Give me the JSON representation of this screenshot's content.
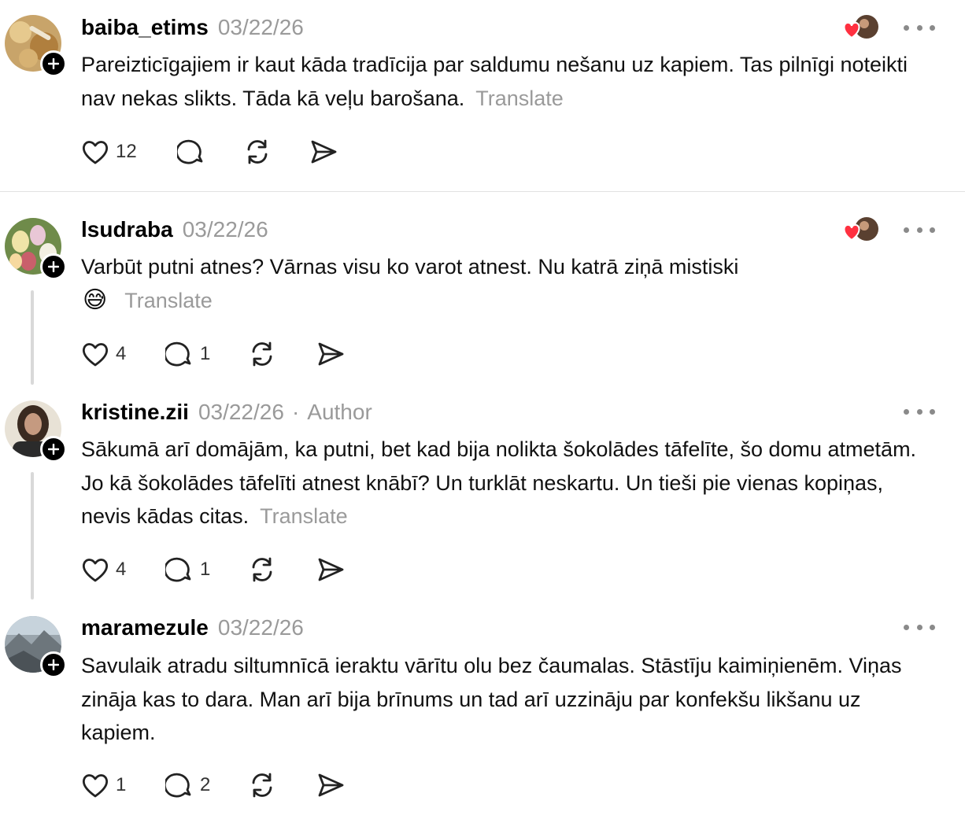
{
  "posts": [
    {
      "username": "baiba_etims",
      "date": "03/22/26",
      "text": "Pareizticīgajiem ir kaut kāda tradīcija par saldumu nešanu uz kapiem. Tas pilnīgi noteikti nav nekas slikts. Tāda kā veļu barošana.",
      "translate": "Translate",
      "likes": "12",
      "replies": "",
      "liked_by_op": true
    },
    {
      "username": "lsudraba",
      "date": "03/22/26",
      "text": "Varbūt putni atnes? Vārnas visu ko varot atnest. Nu katrā ziņā mistiski",
      "emoji": "😅",
      "translate": "Translate",
      "likes": "4",
      "replies": "1",
      "liked_by_op": true
    },
    {
      "username": "kristine.zii",
      "date": "03/22/26",
      "separator": "·",
      "badge": "Author",
      "text": "Sākumā arī domājām, ka putni, bet kad bija nolikta šokolādes tāfelīte, šo domu atmetām. Jo kā šokolādes tāfelīti atnest knābī? Un turklāt neskartu. Un tieši pie vienas kopiņas, nevis kādas citas.",
      "translate": "Translate",
      "likes": "4",
      "replies": "1"
    },
    {
      "username": "maramezule",
      "date": "03/22/26",
      "text": "Savulaik atradu siltumnīcā ieraktu vārītu olu bez čaumalas. Stāstīju kaimiņienēm. Viņas zināja kas to dara. Man arī bija brīnums un tad arī uzzināju par konfekšu likšanu uz kapiem.",
      "likes": "1",
      "replies": "2"
    }
  ],
  "icons": {
    "like": "heart-outline-icon",
    "reply": "speech-bubble-icon",
    "repost": "repost-icon",
    "share": "send-icon",
    "more": "more-dots-icon",
    "follow": "plus-icon"
  },
  "colors": {
    "liked_heart": "#ff3040",
    "muted_text": "#9a9a9a",
    "thread_line": "#d9d9d9"
  }
}
